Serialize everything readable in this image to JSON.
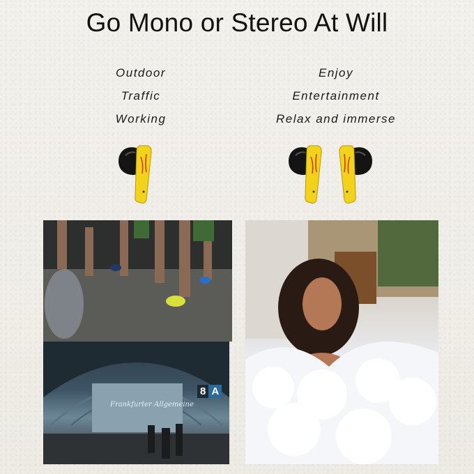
{
  "title": "Go Mono or Stereo At Will",
  "left_column": {
    "lines": [
      "Outdoor",
      "Traffic",
      "Working"
    ]
  },
  "right_column": {
    "lines": [
      "Enjoy",
      "Entertainment",
      "Relax and immerse"
    ]
  },
  "station": {
    "platform_number": "8",
    "platform_letter": "A",
    "sign_text": "Frankfurter Allgemeine"
  },
  "colors": {
    "earbud_yellow": "#f2d21a",
    "earbud_black": "#141414",
    "earbud_red": "#d2391e",
    "text": "#111111"
  }
}
